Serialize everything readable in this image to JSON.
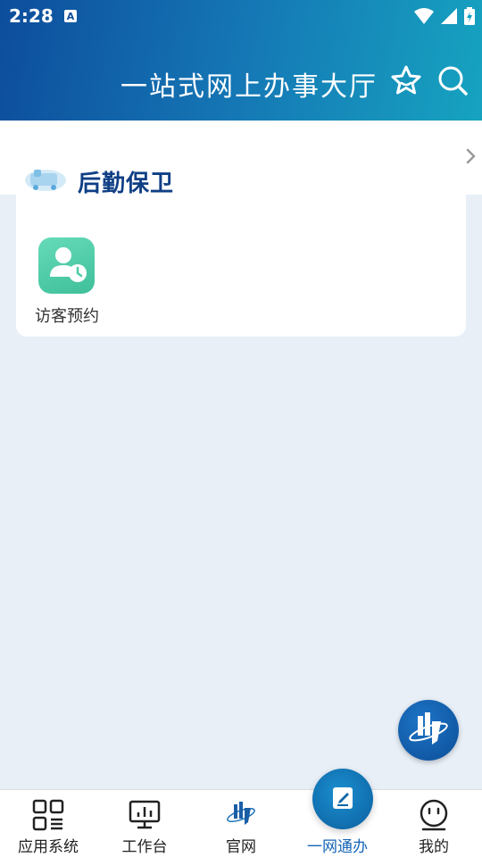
{
  "status_bar": {
    "time": "2:28"
  },
  "header": {
    "title": "一站式网上办事大厅"
  },
  "section": {
    "title": "后勤保卫"
  },
  "apps": [
    {
      "label": "访客预约"
    }
  ],
  "tabbar": [
    {
      "label": "应用系统"
    },
    {
      "label": "工作台"
    },
    {
      "label": "官网"
    },
    {
      "label": "一网通办"
    },
    {
      "label": "我的"
    }
  ],
  "colors": {
    "accent": "#1565b5",
    "header_start": "#0d4d9c",
    "header_end": "#16a3c0",
    "app_icon": "#4fcca8"
  }
}
